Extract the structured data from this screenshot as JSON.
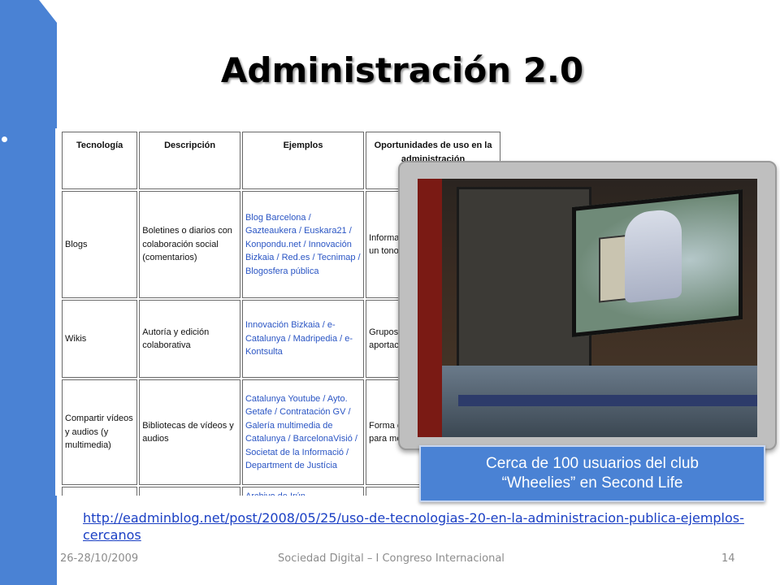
{
  "slide": {
    "title": "Administración 2.0",
    "caption_line1": "Cerca de 100 usuarios del club",
    "caption_line2": "“Wheelies” en Second Life",
    "url": "http://eadminblog.net/post/2008/05/25/uso-de-tecnologias-20-en-la-administracion-publica-ejemplos-cercanos",
    "footer": {
      "date": "26-28/10/2009",
      "event": "Sociedad Digital – I Congreso Internacional",
      "page": "14"
    }
  },
  "table": {
    "headers": [
      "Tecnología",
      "Descripción",
      "Ejemplos",
      "Oportunidades de uso en la administración"
    ],
    "rows": [
      {
        "tech": "Blogs",
        "desc": "Boletines o diarios con colaboración social (comentarios)",
        "examples": "Blog Barcelona / Gazteaukera / Euskara21 / Konpondu.net / Innovación Bizkaia / Red.es / Tecnimap / Blogosfera pública",
        "opps": "Informa distribu audienc human un tono conver"
      },
      {
        "tech": "Wikis",
        "desc": "Autoría y edición colaborativa",
        "examples": "Innovación Bizkaia / e-Catalunya / Madripedia / e-Kontsulta",
        "opps": "Grupos colabo gestión conoci aportac"
      },
      {
        "tech": "Compartir vídeos y audios (y multimedia)",
        "desc": "Bibliotecas de vídeos y audios",
        "examples": "Catalunya Youtube / Ayto. Getafe / Contratación GV / Galería multimedia de Catalunya / BarcelonaVisió / Societat de la Informació / Department de Justícia",
        "opps": "Forma comun audien audios para mejora"
      },
      {
        "tech": "",
        "desc": "",
        "examples": "Archivo de Irún",
        "opps": ""
      }
    ]
  }
}
